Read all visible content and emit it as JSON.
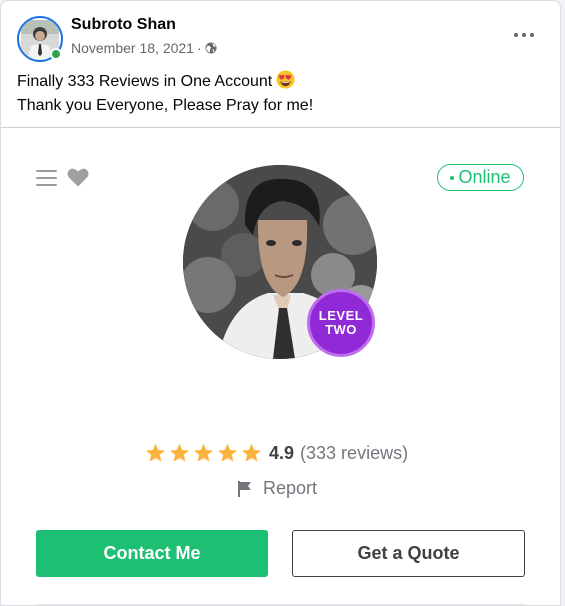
{
  "post": {
    "author": "Subroto Shan",
    "date": "November 18, 2021",
    "separator": "·",
    "audience_icon": "globe-icon",
    "more_icon": "more-options-icon",
    "caption_line1": "Finally 333 Reviews in One Account",
    "caption_emoji": "heart-eyes-emoji",
    "caption_line2": "Thank you Everyone, Please Pray for me!"
  },
  "profile_card": {
    "status": "Online",
    "level_line1": "LEVEL",
    "level_line2": "TWO",
    "rating_value": "4.9",
    "rating_count": "(333 reviews)",
    "stars": 5,
    "report_label": "Report",
    "contact_label": "Contact Me",
    "quote_label": "Get a Quote"
  },
  "colors": {
    "facebook_blue": "#1b74e4",
    "fiverr_green": "#1dbf73",
    "star_gold": "#ffb33e",
    "level_purple": "#8f2ad6"
  }
}
